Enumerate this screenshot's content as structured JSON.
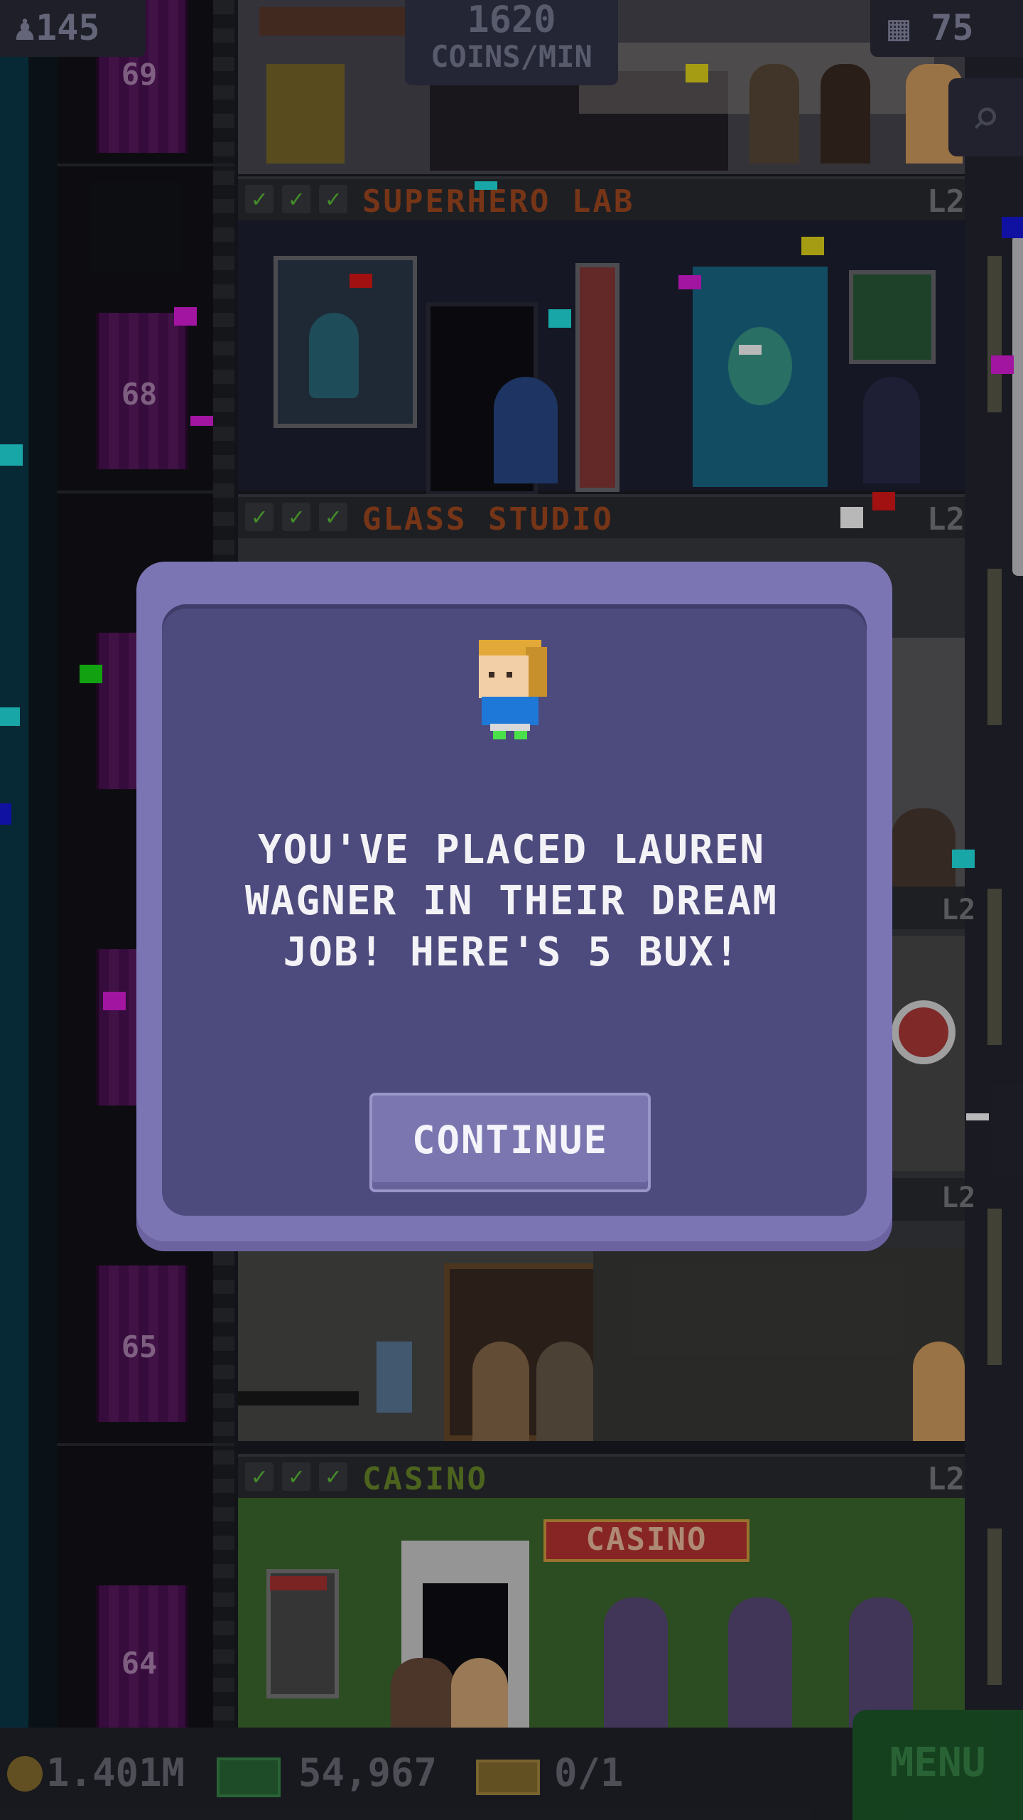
{
  "hud": {
    "population": "145",
    "coins_per_min_value": "1620",
    "coins_per_min_label": "COINS/MIN",
    "floors": "75"
  },
  "shaft": {
    "floor_numbers": [
      "69",
      "68",
      "65",
      "64"
    ]
  },
  "floors": [
    {
      "name": "SUPERHERO LAB",
      "level": "L2"
    },
    {
      "name": "GLASS STUDIO",
      "level": "L2"
    },
    {
      "name": "CASINO",
      "level": "L2"
    }
  ],
  "casino_sign": "CASINO",
  "hidden_floor_levels": [
    "L2",
    "L2"
  ],
  "modal": {
    "message_line1": "YOU'VE PLACED LAUREN",
    "message_line2": "WAGNER IN THEIR DREAM",
    "message_line3": "JOB! HERE'S 5 BUX!",
    "button": "CONTINUE"
  },
  "bottom_bar": {
    "coins": "1.401M",
    "bux": "54,967",
    "tickets": "0/1",
    "menu": "MENU"
  },
  "colors": {
    "modal_outer": "#7c75b3",
    "modal_inner": "#4d4a7d",
    "floor_name": "#a54a20",
    "check": "#5fc23b"
  }
}
